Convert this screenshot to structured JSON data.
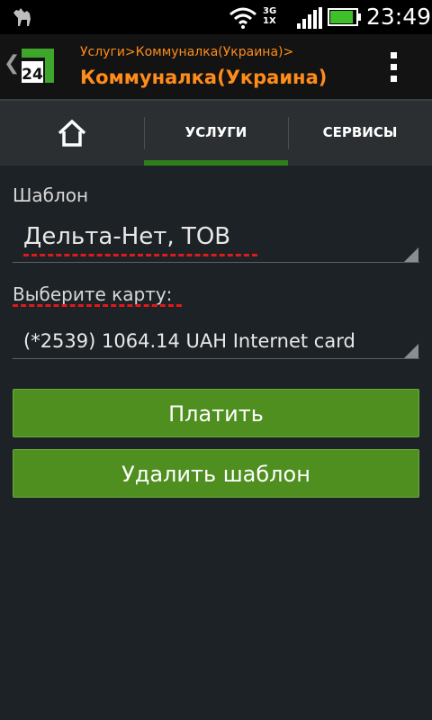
{
  "status_bar": {
    "time": "23:49",
    "network_top": "3G",
    "network_bottom": "1X",
    "icons": [
      "camel-notification-icon",
      "wifi-icon",
      "signal-icon",
      "battery-icon"
    ],
    "battery_level": 0.9
  },
  "app_bar": {
    "logo_text": "24",
    "breadcrumb": "Услуги>Коммуналка(Украина)>",
    "title": "Коммуналка(Украина)",
    "accent_color": "#ff8c1a"
  },
  "tabs": {
    "items": [
      {
        "label": "",
        "icon": "home-icon"
      },
      {
        "label": "УСЛУГИ",
        "selected": true
      },
      {
        "label": "СЕРВИСЫ"
      }
    ]
  },
  "form": {
    "template_label": "Шаблон",
    "template_value": "Дельта-Нет, ТОВ",
    "card_label": "Выберите карту:",
    "card_value": "(*2539) 1064.14 UAH Internet card"
  },
  "buttons": {
    "pay": "Платить",
    "delete_template": "Удалить шаблон"
  },
  "colors": {
    "button_green": "#4e8f1f",
    "tab_underline": "#2f7d1b",
    "background": "#1d2226"
  }
}
